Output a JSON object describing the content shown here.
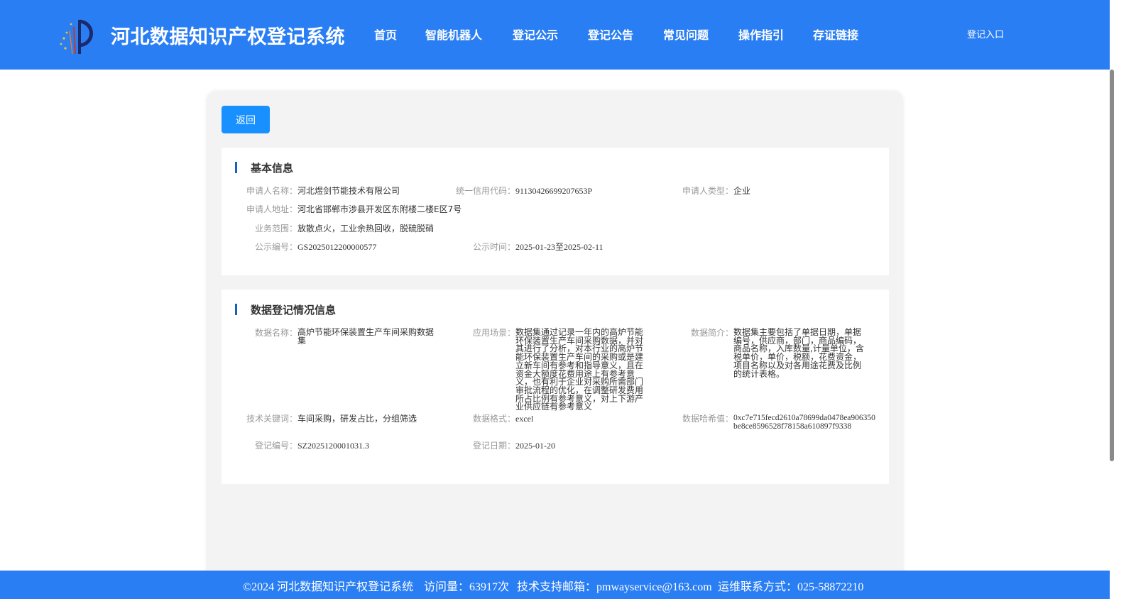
{
  "header": {
    "site_title": "河北数据知识产权登记系统",
    "logo": "logo-icon",
    "nav": [
      "首页",
      "智能机器人",
      "登记公示",
      "登记公告",
      "常见问题",
      "操作指引",
      "存证链接"
    ],
    "login_label": "登记入口",
    "colors": {
      "bar": "#2a7ef4",
      "text": "#ffffff"
    }
  },
  "main": {
    "back_label": "返回",
    "basic": {
      "title": "基本信息",
      "applicant_name_label": "申请人名称：",
      "applicant_name": "河北煜剑节能技术有限公司",
      "credit_code_label": "统一信用代码：",
      "credit_code": "91130426699207653P",
      "applicant_type_label": "申请人类型：",
      "applicant_type": "企业",
      "address_label": "申请人地址：",
      "address": "河北省邯郸市涉县开发区东附楼二楼E区7号",
      "scope_label": "业务范围：",
      "scope": "放散点火，工业余热回收，脱硫脱硝",
      "notice_no_label": "公示编号：",
      "notice_no": "GS2025012200000577",
      "notice_time_label": "公示时间：",
      "notice_time": "2025-01-23至2025-02-11"
    },
    "data_info": {
      "title": "数据登记情况信息",
      "name_label": "数据名称：",
      "name": "高炉节能环保装置生产车间采购数据集",
      "scenario_label": "应用场景：",
      "scenario": "数据集通过记录一年内的高炉节能环保装置生产车间采购数据，并对其进行了分析，对本行业的高炉节能环保装置生产车间的采购或是建立新车间有参考和指导意义，且在资金大额度花费用途上有参考意义，也有利于企业对采购所需部门审批流程的优化，在调整研发费用所占比例有参考意义，对上下游产业供应链有参考意义",
      "intro_label": "数据简介：",
      "intro": "数据集主要包括了单据日期，单据编号，供应商，部门，商品编码，商品名称，入库数量,计量单位，含税单价，单价，税额，花费资金，项目名称以及对各用途花费及比例的统计表格。",
      "keywords_label": "技术关键词：",
      "keywords": "车间采购，研发占比，分组筛选",
      "format_label": "数据格式：",
      "format": "excel",
      "hash_label": "数据哈希值：",
      "hash": "0xc7e715fecd2610a78699da0478ea906350be8ce8596528f78158a610897f9338",
      "reg_no_label": "登记编号：",
      "reg_no": "SZ2025120001031.3",
      "reg_date_label": "登记日期：",
      "reg_date": "2025-01-20"
    }
  },
  "footer": {
    "copyright": "©2024 河北数据知识产权登记系统",
    "visits": "访问量：63917次",
    "email": "技术支持邮箱：pmwayservice@163.com",
    "phone": "运维联系方式：025-58872210"
  }
}
